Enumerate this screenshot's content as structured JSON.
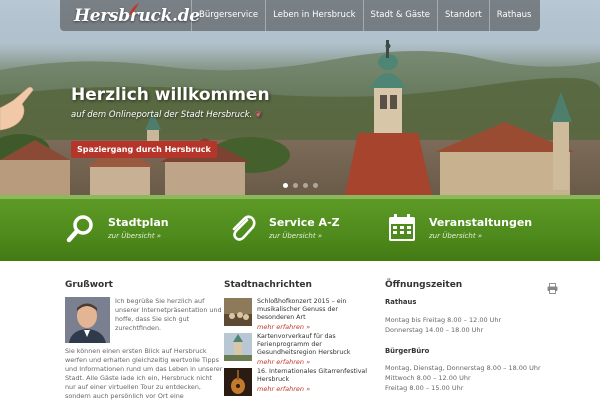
{
  "header": {
    "logo_text": "Hersbruck.de",
    "nav": [
      "Bürgerservice",
      "Leben in Hersbruck",
      "Stadt & Gäste",
      "Standort",
      "Rathaus"
    ]
  },
  "hero": {
    "title": "Herzlich willkommen",
    "subtitle": "auf dem Onlineportal der Stadt Hersbruck.",
    "button": "Spaziergang durch Hersbruck",
    "slides": 4,
    "active_slide": 1
  },
  "quicklinks": [
    {
      "icon": "magnifier-icon",
      "title": "Stadtplan",
      "link": "zur Übersicht »"
    },
    {
      "icon": "paperclip-icon",
      "title": "Service A-Z",
      "link": "zur Übersicht »"
    },
    {
      "icon": "calendar-icon",
      "title": "Veranstaltungen",
      "link": "zur Übersicht »"
    }
  ],
  "grusswort": {
    "heading": "Grußwort",
    "text1": "Ich begrüße Sie herzlich auf unserer Internetpräsentation und hoffe, dass Sie sich gut zurechtfinden.",
    "text2": "Sie können einen ersten Blick auf Hersbruck werfen und erhalten gleichzeitig wertvolle Tipps und Informationen rund um das Leben in unserer Stadt. Alle Gäste lade ich ein, Hersbruck nicht nur auf einer virtuellen Tour zu entdecken, sondern auch persönlich vor Ort eine"
  },
  "news": {
    "heading": "Stadtnachrichten",
    "more_label": "mehr erfahren »",
    "items": [
      {
        "title": "Schloßhofkonzert 2015 – ein musikalischer Genuss der besonderen Art"
      },
      {
        "title": "Kartenvorverkauf für das Ferienprogramm der Gesundheitsregion Hersbruck"
      },
      {
        "title": "16. Internationales Gitarrenfestival Hersbruck"
      }
    ]
  },
  "hours": {
    "heading": "Öffnungszeiten",
    "rathaus": {
      "label": "Rathaus",
      "lines": [
        "Montag bis Freitag 8.00 – 12.00 Uhr",
        "Donnerstag 14.00 – 18.00 Uhr"
      ]
    },
    "buergerbuero": {
      "label": "BürgerBüro",
      "lines": [
        "Montag, Dienstag, Donnerstag 8.00 – 18.00 Uhr",
        "Mittwoch 8.00 – 12.00 Uhr",
        "Freitag 8.00 – 15.00 Uhr"
      ]
    }
  },
  "colors": {
    "green": "#4e8a1c",
    "red": "#b5352a",
    "link_red": "#c0392b"
  }
}
